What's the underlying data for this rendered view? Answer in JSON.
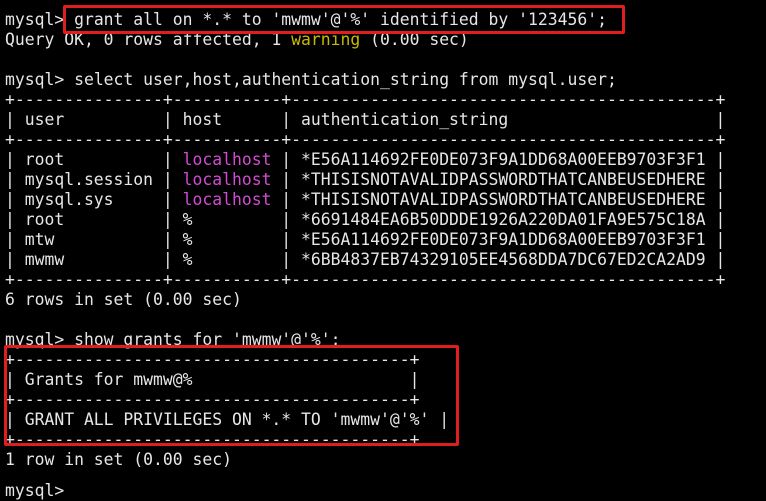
{
  "terminal": {
    "grant": {
      "prompt": "mysql> ",
      "command": "grant all on *.* to 'mwmw'@'%' identified by '123456';"
    },
    "grant_result": {
      "pre": "Query OK, 0 rows affected, 1 ",
      "warning": "warning",
      "post": " (0.00 sec)"
    },
    "select": {
      "prompt": "mysql> ",
      "command": "select user,host,authentication_string from mysql.user;"
    },
    "user_table": {
      "border": "+---------------+-----------+-------------------------------------------+",
      "header": {
        "col1": "| user          | ",
        "col2": "host     ",
        "col3": " | authentication_string                     |"
      },
      "rows": [
        {
          "c1": "| root          | ",
          "c2": "localhost",
          "c3": " | *E56A114692FE0DE073F9A1DD68A00EEB9703F3F1 |"
        },
        {
          "c1": "| mysql.session | ",
          "c2": "localhost",
          "c3": " | *THISISNOTAVALIDPASSWORDTHATCANBEUSEDHERE |"
        },
        {
          "c1": "| mysql.sys     | ",
          "c2": "localhost",
          "c3": " | *THISISNOTAVALIDPASSWORDTHATCANBEUSEDHERE |"
        },
        {
          "c1": "| root          | ",
          "c2": "%        ",
          "c3": " | *6691484EA6B50DDDE1926A220DA01FA9E575C18A |"
        },
        {
          "c1": "| mtw           | ",
          "c2": "%        ",
          "c3": " | *E56A114692FE0DE073F9A1DD68A00EEB9703F3F1 |"
        },
        {
          "c1": "| mwmw          | ",
          "c2": "%        ",
          "c3": " | *6BB4837EB74329105EE4568DDA7DC67ED2CA2AD9 |"
        }
      ],
      "summary": "6 rows in set (0.00 sec)"
    },
    "show": {
      "prompt": "mysql> ",
      "command": "show grants for 'mwmw'@'%';"
    },
    "grants_table": {
      "border": "+----------------------------------------+",
      "header": "| Grants for mwmw@%                      |",
      "row": "| GRANT ALL PRIVILEGES ON *.* TO 'mwmw'@'%' |",
      "summary": "1 row in set (0.00 sec)"
    },
    "cursor_prompt": "mysql> "
  },
  "colors": {
    "background": "#000000",
    "text": "#e6e6e6",
    "warning": "#c9b800",
    "host_localhost": "#d24bd2",
    "highlight_box": "#e01e1e"
  }
}
